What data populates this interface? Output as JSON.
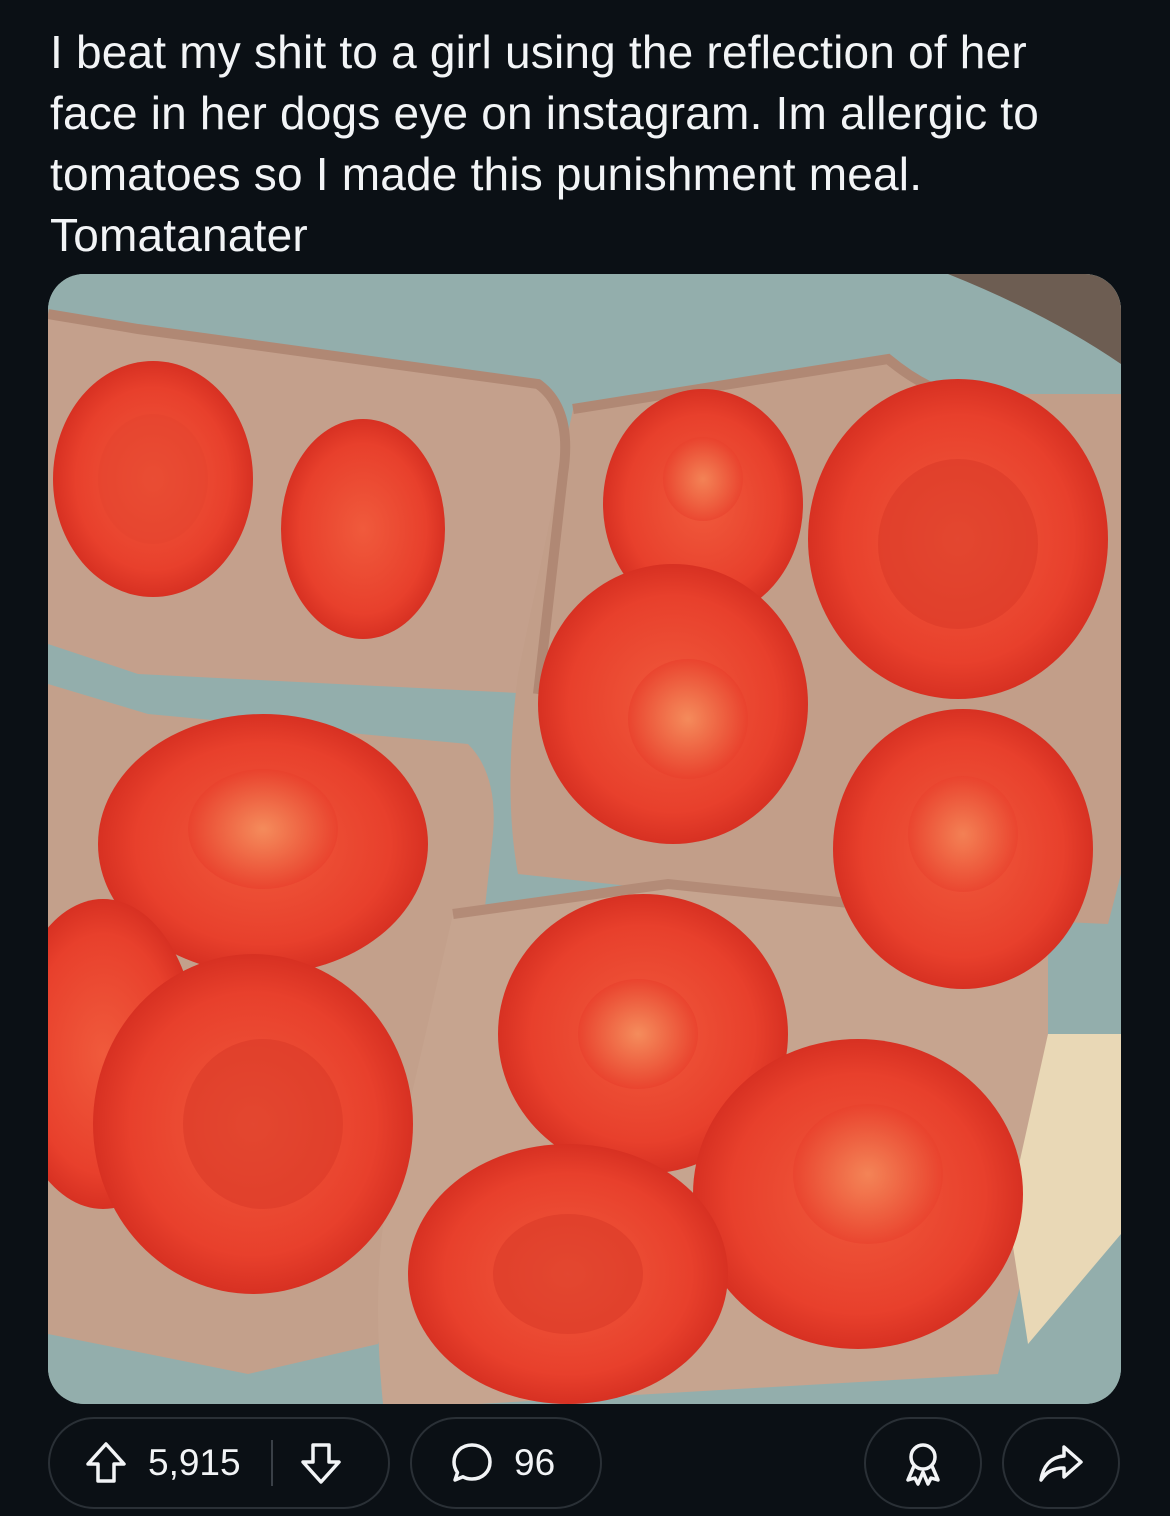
{
  "post": {
    "title": "I beat my shit to a girl using the reflection of her face in her dogs eye on instagram.  Im allergic to tomatoes so I made this punishment meal. Tomatanater"
  },
  "actions": {
    "upvote_count": "5,915",
    "comment_count": "96"
  },
  "colors": {
    "background": "#0b1015",
    "text": "#f2f4f6",
    "pill_border": "#2a3036"
  },
  "icons": {
    "upvote": "arrow-up-icon",
    "downvote": "arrow-down-icon",
    "comment": "speech-bubble-icon",
    "award": "award-ribbon-icon",
    "share": "share-arrow-icon"
  }
}
